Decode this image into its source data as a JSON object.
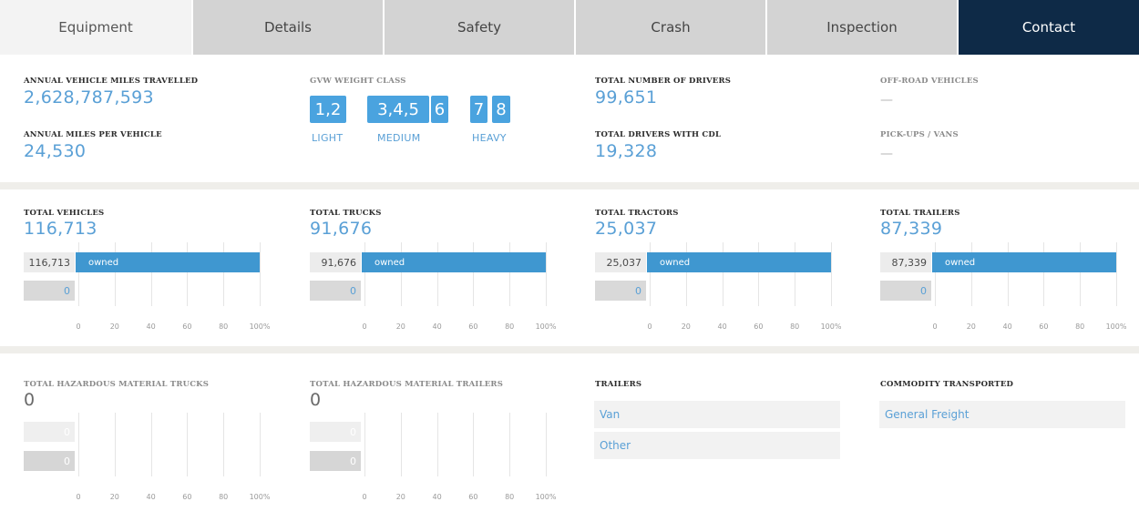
{
  "tabs": [
    "Equipment",
    "Details",
    "Safety",
    "Crash",
    "Inspection",
    "Contact"
  ],
  "overview": {
    "annual_vmt_label": "ANNUAL VEHICLE MILES TRAVELLED",
    "annual_vmt_value": "2,628,787,593",
    "miles_per_vehicle_label": "ANNUAL MILES PER VEHICLE",
    "miles_per_vehicle_value": "24,530",
    "gvw_label": "GVW WEIGHT CLASS",
    "gvw_classes": [
      "1,2",
      "3,4,5",
      "6",
      "7",
      "8"
    ],
    "gvw_captions": [
      "LIGHT",
      "MEDIUM",
      "HEAVY"
    ],
    "total_drivers_label": "TOTAL NUMBER OF DRIVERS",
    "total_drivers_value": "99,651",
    "cdl_drivers_label": "TOTAL DRIVERS WITH CDL",
    "cdl_drivers_value": "19,328",
    "offroad_label": "OFF-ROAD VEHICLES",
    "offroad_value": "—",
    "pickups_label": "PICK-UPS / VANS",
    "pickups_value": "—"
  },
  "vehicle_charts": [
    {
      "label": "TOTAL VEHICLES",
      "total": "116,713",
      "owned_value": "116,713",
      "owned_label": "owned",
      "owned_fraction": 1.0,
      "second_value": "0"
    },
    {
      "label": "TOTAL TRUCKS",
      "total": "91,676",
      "owned_value": "91,676",
      "owned_label": "owned",
      "owned_fraction": 1.0,
      "second_value": "0"
    },
    {
      "label": "TOTAL TRACTORS",
      "total": "25,037",
      "owned_value": "25,037",
      "owned_label": "owned",
      "owned_fraction": 1.0,
      "second_value": "0"
    },
    {
      "label": "TOTAL TRAILERS",
      "total": "87,339",
      "owned_value": "87,339",
      "owned_label": "owned",
      "owned_fraction": 1.0,
      "second_value": "0"
    }
  ],
  "axis_ticks": [
    "0",
    "20",
    "40",
    "60",
    "80",
    "100%"
  ],
  "hazmat_charts": [
    {
      "label": "TOTAL HAZARDOUS MATERIAL TRUCKS",
      "total": "0",
      "first_value": "0",
      "second_value": "0"
    },
    {
      "label": "TOTAL HAZARDOUS MATERIAL TRAILERS",
      "total": "0",
      "first_value": "0",
      "second_value": "0"
    }
  ],
  "trailers": {
    "label": "TRAILERS",
    "items": [
      "Van",
      "Other"
    ]
  },
  "commodity": {
    "label": "COMMODITY TRANSPORTED",
    "items": [
      "General Freight"
    ]
  },
  "colors": {
    "accent": "#3f97d0",
    "value_text": "#5aa0d6",
    "active_tab": "#0e2a47",
    "tab": "#d3d3d3"
  }
}
